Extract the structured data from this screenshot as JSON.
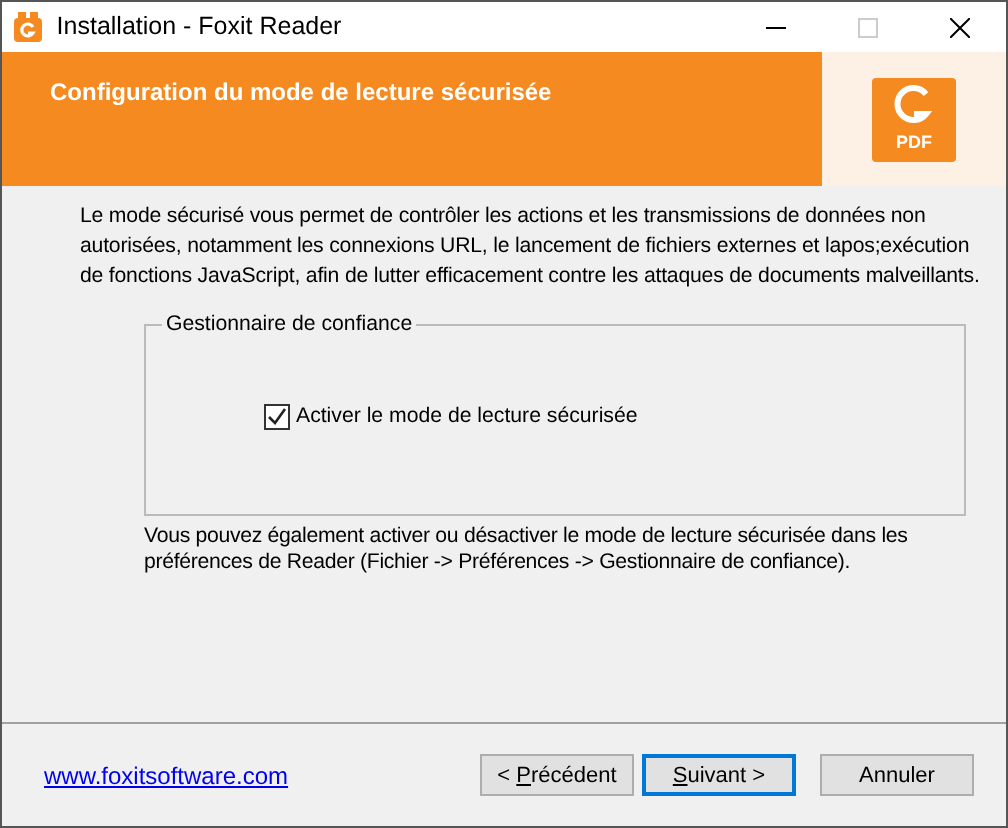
{
  "window": {
    "title": "Installation - Foxit Reader"
  },
  "header": {
    "title": "Configuration du mode de lecture sécurisée",
    "logo_label": "PDF"
  },
  "description": "Le mode sécurisé vous permet de contrôler les actions et les transmissions de données non autorisées, notamment les connexions URL, le lancement de fichiers externes et lapos;exécution de fonctions JavaScript, afin de lutter efficacement contre les attaques de documents malveillants.",
  "group": {
    "title": "Gestionnaire de confiance",
    "checkbox": {
      "label": "Activer le mode de lecture sécurisée",
      "checked": true
    }
  },
  "note": "Vous pouvez également activer ou désactiver le mode de lecture sécurisée dans les préférences de Reader (Fichier -> Préférences -> Gestionnaire de confiance).",
  "link": "www.foxitsoftware.com",
  "buttons": [
    {
      "before": "< ",
      "key": "P",
      "after": "récédent",
      "default": false
    },
    {
      "key": "S",
      "after": "uivant >",
      "default": true
    },
    {
      "before": "Annuler",
      "default": false
    }
  ]
}
